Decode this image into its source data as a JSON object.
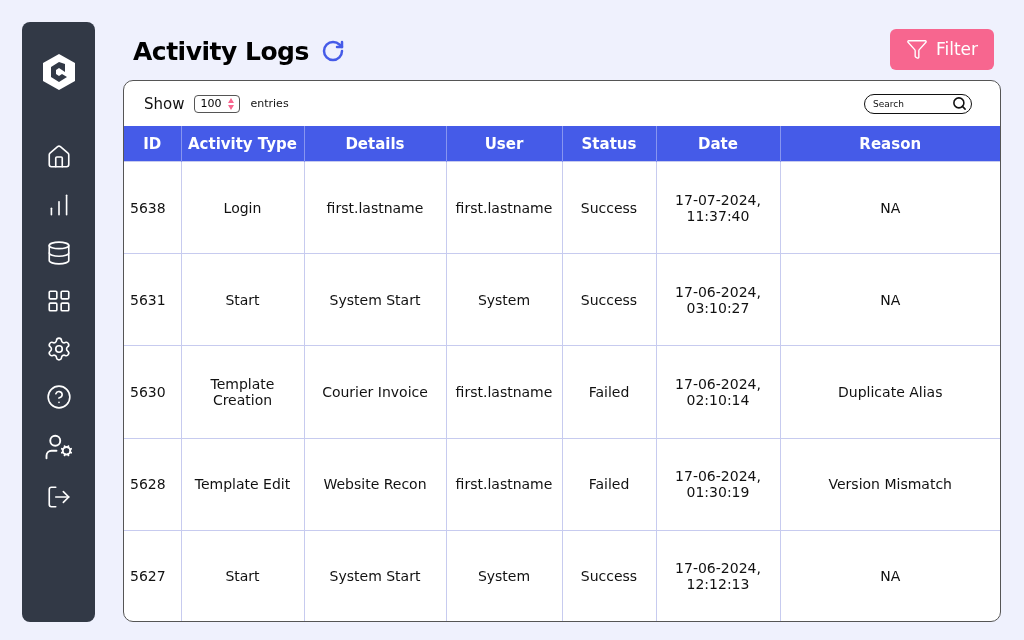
{
  "header": {
    "title": "Activity Logs",
    "filter_button": "Filter"
  },
  "controls": {
    "show_label": "Show",
    "entries_value": "100",
    "entries_label": "entries",
    "search": {
      "placeholder": "Search"
    }
  },
  "table": {
    "columns": [
      "ID",
      "Activity Type",
      "Details",
      "User",
      "Status",
      "Date",
      "Reason"
    ],
    "rows": [
      {
        "cells": [
          "5638",
          "Login",
          "first.lastname",
          "first.lastname",
          "Success",
          "17-07-2024, 11:37:40",
          "NA"
        ]
      },
      {
        "cells": [
          "5631",
          "Start",
          "System Start",
          "System",
          "Success",
          "17-06-2024, 03:10:27",
          "NA"
        ]
      },
      {
        "cells": [
          "5630",
          "Template Creation",
          "Courier Invoice",
          "first.lastname",
          "Failed",
          "17-06-2024, 02:10:14",
          "Duplicate Alias"
        ]
      },
      {
        "cells": [
          "5628",
          "Template Edit",
          "Website Recon",
          "first.lastname",
          "Failed",
          "17-06-2024, 01:30:19",
          "Version Mismatch"
        ]
      },
      {
        "cells": [
          "5627",
          "Start",
          "System Start",
          "System",
          "Success",
          "17-06-2024, 12:12:13",
          "NA"
        ]
      }
    ]
  }
}
